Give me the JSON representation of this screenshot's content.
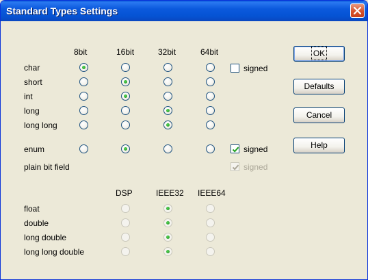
{
  "window": {
    "title": "Standard Types Settings"
  },
  "int_columns": [
    "8bit",
    "16bit",
    "32bit",
    "64bit"
  ],
  "int_types": [
    {
      "label": "char",
      "selected": 0
    },
    {
      "label": "short",
      "selected": 1
    },
    {
      "label": "int",
      "selected": 1
    },
    {
      "label": "long",
      "selected": 2
    },
    {
      "label": "long long",
      "selected": 2
    }
  ],
  "enum": {
    "label": "enum",
    "selected": 1
  },
  "plain_bit_field": {
    "label": "plain bit field"
  },
  "signed_checks": {
    "char": {
      "label": "signed",
      "checked": false,
      "enabled": true
    },
    "enum": {
      "label": "signed",
      "checked": true,
      "enabled": true
    },
    "plain_bit_field": {
      "label": "signed",
      "checked": true,
      "enabled": false
    }
  },
  "float_columns": [
    "DSP",
    "IEEE32",
    "IEEE64"
  ],
  "float_types": [
    {
      "label": "float",
      "selected": 1
    },
    {
      "label": "double",
      "selected": 1
    },
    {
      "label": "long double",
      "selected": 1
    },
    {
      "label": "long long double",
      "selected": 1
    }
  ],
  "buttons": {
    "ok": "OK",
    "defaults": "Defaults",
    "cancel": "Cancel",
    "help": "Help"
  },
  "colors": {
    "titlebar": "#0553d3",
    "dialog_bg": "#ece9d8",
    "radio_dot": "#21a121",
    "disabled_text": "#aca899"
  }
}
